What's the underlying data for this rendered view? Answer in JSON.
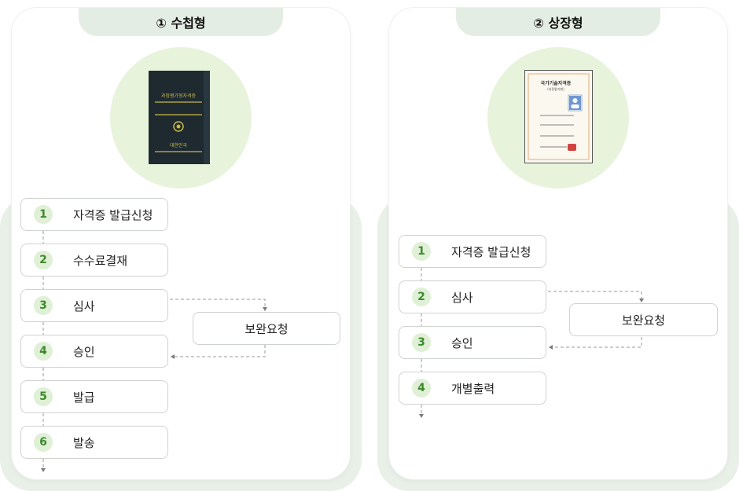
{
  "left": {
    "title": "① 수첩형",
    "booklet": {
      "top_text": "과정평가형자격증",
      "bottom_text": "대한민국"
    },
    "steps": [
      {
        "num": "1",
        "label": "자격증 발급신청"
      },
      {
        "num": "2",
        "label": "수수료결재"
      },
      {
        "num": "3",
        "label": "심사"
      },
      {
        "num": "4",
        "label": "승인"
      },
      {
        "num": "5",
        "label": "발급"
      },
      {
        "num": "6",
        "label": "발송"
      }
    ],
    "supplement": "보완요청"
  },
  "right": {
    "title": "② 상장형",
    "certificate": {
      "title": "국가기술자격증",
      "subtitle": "(과정평가형)"
    },
    "steps": [
      {
        "num": "1",
        "label": "자격증 발급신청"
      },
      {
        "num": "2",
        "label": "심사"
      },
      {
        "num": "3",
        "label": "승인"
      },
      {
        "num": "4",
        "label": "개별출력"
      }
    ],
    "supplement": "보완요청"
  },
  "colors": {
    "accent_green": "#3d8a2c",
    "booklet_dark": "#1f2a30",
    "booklet_gold": "#c9b94a",
    "seal_red": "#d0433f"
  }
}
